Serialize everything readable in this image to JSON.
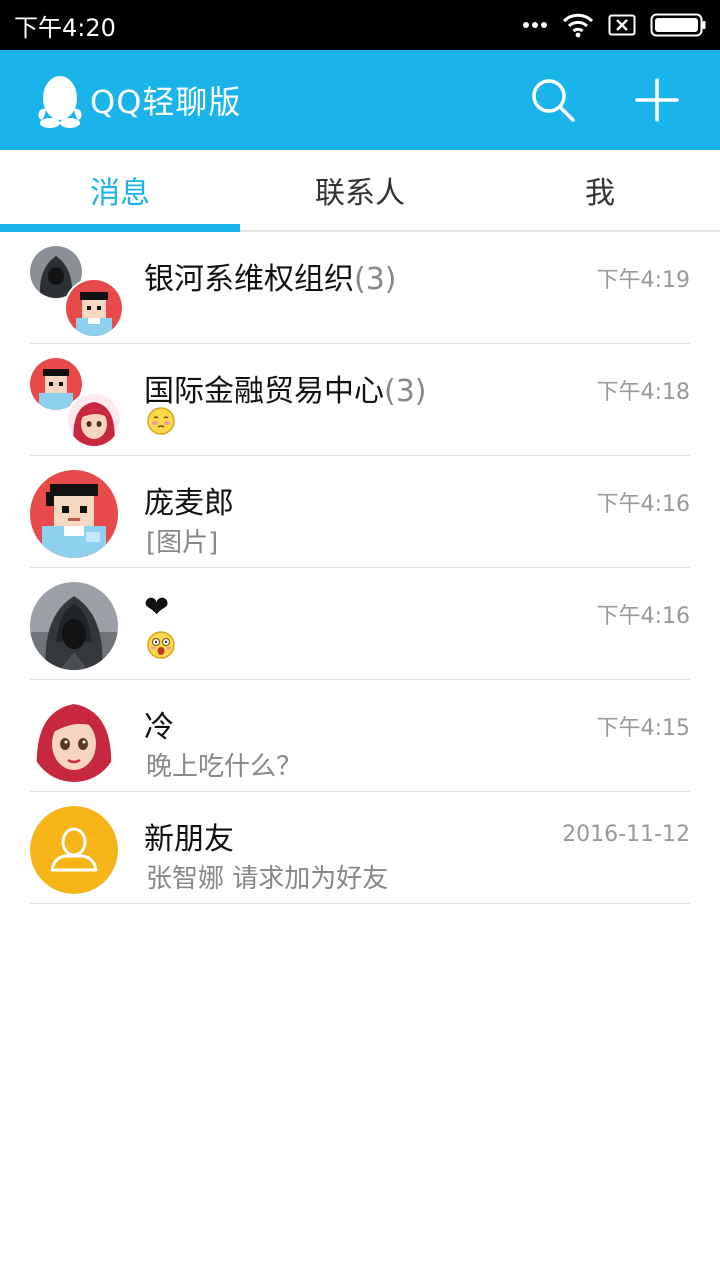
{
  "status_bar": {
    "time": "下午4:20"
  },
  "app_bar": {
    "title": "QQ轻聊版",
    "accent": "#1ab3ea"
  },
  "tabs": [
    {
      "label": "消息",
      "active": true
    },
    {
      "label": "联系人",
      "active": false
    },
    {
      "label": "我",
      "active": false
    }
  ],
  "conversations": [
    {
      "name": "银河系维权组织",
      "count": "(3)",
      "time": "下午4:19",
      "preview": "",
      "avatar": "group-avatar"
    },
    {
      "name": "国际金融贸易中心",
      "count": "(3)",
      "time": "下午4:18",
      "preview": "",
      "preview_icon": "blush-emoji-icon",
      "avatar": "group-avatar"
    },
    {
      "name": "庞麦郎",
      "count": "",
      "time": "下午4:16",
      "preview": "[图片]",
      "avatar": "pixel-avatar"
    },
    {
      "name": "❤",
      "count": "",
      "time": "下午4:16",
      "preview": "",
      "preview_icon": "shocked-emoji-icon",
      "avatar": "hooded-avatar"
    },
    {
      "name": "冷",
      "count": "",
      "time": "下午4:15",
      "preview": "晚上吃什么？",
      "avatar": "redhair-avatar"
    },
    {
      "name": "新朋友",
      "count": "",
      "time": "2016-11-12",
      "preview": "张智娜 请求加为好友",
      "avatar": "new-friend-avatar"
    }
  ]
}
